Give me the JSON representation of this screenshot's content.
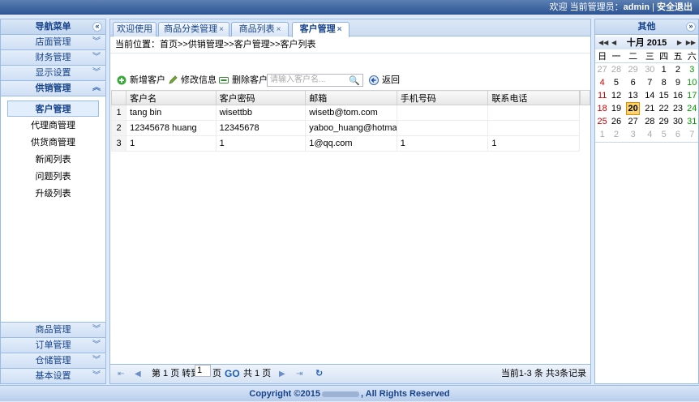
{
  "topbar": {
    "welcome": "欢迎 当前管理员：",
    "user": "admin",
    "sep": " | ",
    "logout": "安全退出"
  },
  "left": {
    "title": "导航菜单",
    "collapse_icon": "«",
    "menus": [
      {
        "label": "店面管理",
        "chev": "︾"
      },
      {
        "label": "财务管理",
        "chev": "︾"
      },
      {
        "label": "显示设置",
        "chev": "︾"
      },
      {
        "label": "供销管理",
        "chev": "︽"
      }
    ],
    "sub_items": [
      {
        "label": "客户管理"
      },
      {
        "label": "代理商管理"
      },
      {
        "label": "供货商管理"
      },
      {
        "label": "新闻列表"
      },
      {
        "label": "问题列表"
      },
      {
        "label": "升级列表"
      }
    ],
    "bottom_menus": [
      {
        "label": "商品管理",
        "chev": "︾"
      },
      {
        "label": "订单管理",
        "chev": "︾"
      },
      {
        "label": "仓储管理",
        "chev": "︾"
      },
      {
        "label": "基本设置",
        "chev": "︾"
      }
    ]
  },
  "tabs": [
    {
      "label": "欢迎使用",
      "close": ""
    },
    {
      "label": "商品分类管理",
      "close": "×"
    },
    {
      "label": "商品列表",
      "close": "×"
    },
    {
      "label": "客户管理",
      "close": "×"
    }
  ],
  "breadcrumb": "当前位置：首页>>供销管理>>客户管理>>客户列表",
  "toolbar": {
    "add": "新增客户",
    "edit": "修改信息",
    "delete": "删除客户",
    "search_placeholder": "请输入客户名...",
    "back": "返回",
    "icons": {
      "add": "add-icon",
      "edit": "pencil-icon",
      "delete": "delete-icon",
      "search": "magnifier-icon",
      "back": "back-arrow-icon"
    }
  },
  "table": {
    "columns": [
      "客户名",
      "客户密码",
      "邮箱",
      "手机号码",
      "联系电话"
    ],
    "rows": [
      {
        "n": "1",
        "cells": [
          "tang bin",
          "wisettbb",
          "wisetb@tom.com",
          "",
          ""
        ]
      },
      {
        "n": "2",
        "cells": [
          "12345678 huang",
          "12345678",
          "yaboo_huang@hotmail.com",
          "",
          ""
        ]
      },
      {
        "n": "3",
        "cells": [
          "1",
          "1",
          "1@qq.com",
          "1",
          "1"
        ]
      }
    ]
  },
  "pager": {
    "first": "⇤",
    "prev": "◀",
    "page_prefix": "第 1 页 转到",
    "page_input": "1",
    "page_suffix": "页",
    "go": "GO",
    "total_pages": "共 1 页",
    "next": "▶",
    "last": "⇥",
    "refresh": "↻",
    "summary": "当前1-3 条 共3条记录"
  },
  "right": {
    "title": "其他",
    "expand_icon": "»",
    "calendar": {
      "month_label": "十月 2015",
      "prev_year": "◀◀",
      "prev_month": "◀",
      "next_month": "▶",
      "next_year": "▶▶",
      "weekdays": [
        "日",
        "一",
        "二",
        "三",
        "四",
        "五",
        "六"
      ],
      "weeks": [
        [
          "27",
          "28",
          "29",
          "30",
          "1",
          "2",
          "3"
        ],
        [
          "4",
          "5",
          "6",
          "7",
          "8",
          "9",
          "10"
        ],
        [
          "11",
          "12",
          "13",
          "14",
          "15",
          "16",
          "17"
        ],
        [
          "18",
          "19",
          "20",
          "21",
          "22",
          "23",
          "24"
        ],
        [
          "25",
          "26",
          "27",
          "28",
          "29",
          "30",
          "31"
        ],
        [
          "1",
          "2",
          "3",
          "4",
          "5",
          "6",
          "7"
        ]
      ],
      "today": "20"
    }
  },
  "footer": {
    "copyright": "Copyright ©2015",
    "rights": ", All Rights Reserved"
  },
  "colors": {
    "accent": "#15428b",
    "border": "#99bbe8",
    "today_bg": "#fbd571"
  }
}
